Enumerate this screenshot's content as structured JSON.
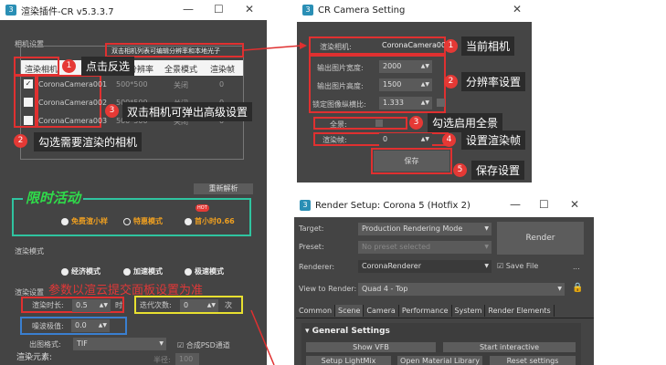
{
  "plugin": {
    "title": "渲染插件-CR v5.3.3.7",
    "camera_section": "相机设置",
    "hint_box": "双击相机列表可编辑分辨率和本地光子",
    "columns": [
      "渲染相机",
      "分辨率",
      "全景模式",
      "渲染帧"
    ],
    "rows": [
      {
        "checked": true,
        "name": "CoronaCamera001",
        "res": "500*500",
        "pano": "关闭",
        "frame": "0"
      },
      {
        "checked": false,
        "name": "CoronaCamera002",
        "res": "500*500",
        "pano": "关闭",
        "frame": "0"
      },
      {
        "checked": false,
        "name": "CoronaCamera003",
        "res": "500*500",
        "pano": "关闭",
        "frame": "0"
      }
    ],
    "reparse": "重新解析",
    "promo_title": "限时活动",
    "promo_options": [
      "免费渲小样",
      "特惠模式",
      "首小时0.66"
    ],
    "hot": "HOT",
    "render_mode_label": "渲染模式",
    "render_modes": [
      "经济模式",
      "加速模式",
      "极速模式"
    ],
    "render_settings_label": "渲染设置",
    "notice": "参数以渲云提交面板设置为准",
    "time_label": "渲染时长:",
    "time_value": "0.5",
    "time_unit": "时",
    "iter_label": "迭代次数:",
    "iter_value": "0",
    "iter_unit": "次",
    "noise_label": "噪波极值:",
    "noise_value": "0.0",
    "format_label": "出图格式:",
    "format_value": "TIF",
    "psd_label": "合成PSD通道",
    "elements_label": "渲染元素:",
    "radius_label": "半径:",
    "radius_value": "100"
  },
  "annotations": {
    "a1": "点击反选",
    "a2": "勾选需要渲染的相机",
    "a3": "双击相机可弹出高级设置",
    "c1": "当前相机",
    "c2": "分辨率设置",
    "c3": "勾选启用全景",
    "c4": "设置渲染帧",
    "c5": "保存设置"
  },
  "camera": {
    "title": "CR Camera Setting",
    "render_cam_label": "渲染相机:",
    "render_cam_value": "CoronaCamera001",
    "width_label": "输出图片宽度:",
    "width_value": "2000",
    "height_label": "输出图片高度:",
    "height_value": "1500",
    "aspect_label": "锁定图像纵横比:",
    "aspect_value": "1.333",
    "pano_label": "全景:",
    "frame_label": "渲染帧:",
    "frame_value": "0",
    "save": "保存"
  },
  "render_setup": {
    "title": "Render Setup: Corona 5 (Hotfix 2)",
    "target_label": "Target:",
    "target_value": "Production Rendering Mode",
    "preset_label": "Preset:",
    "preset_value": "No preset selected",
    "renderer_label": "Renderer:",
    "renderer_value": "CoronaRenderer",
    "save_file": "Save File",
    "view_label": "View to Render:",
    "view_value": "Quad 4 - Top",
    "render": "Render",
    "more": "...",
    "tabs": [
      "Common",
      "Scene",
      "Camera",
      "Performance",
      "System",
      "Render Elements"
    ],
    "active_tab": "Scene",
    "rollout": "General Settings",
    "buttons": [
      "Show VFB",
      "Start interactive",
      "Setup LightMix",
      "Open Material Library",
      "Reset settings"
    ]
  }
}
